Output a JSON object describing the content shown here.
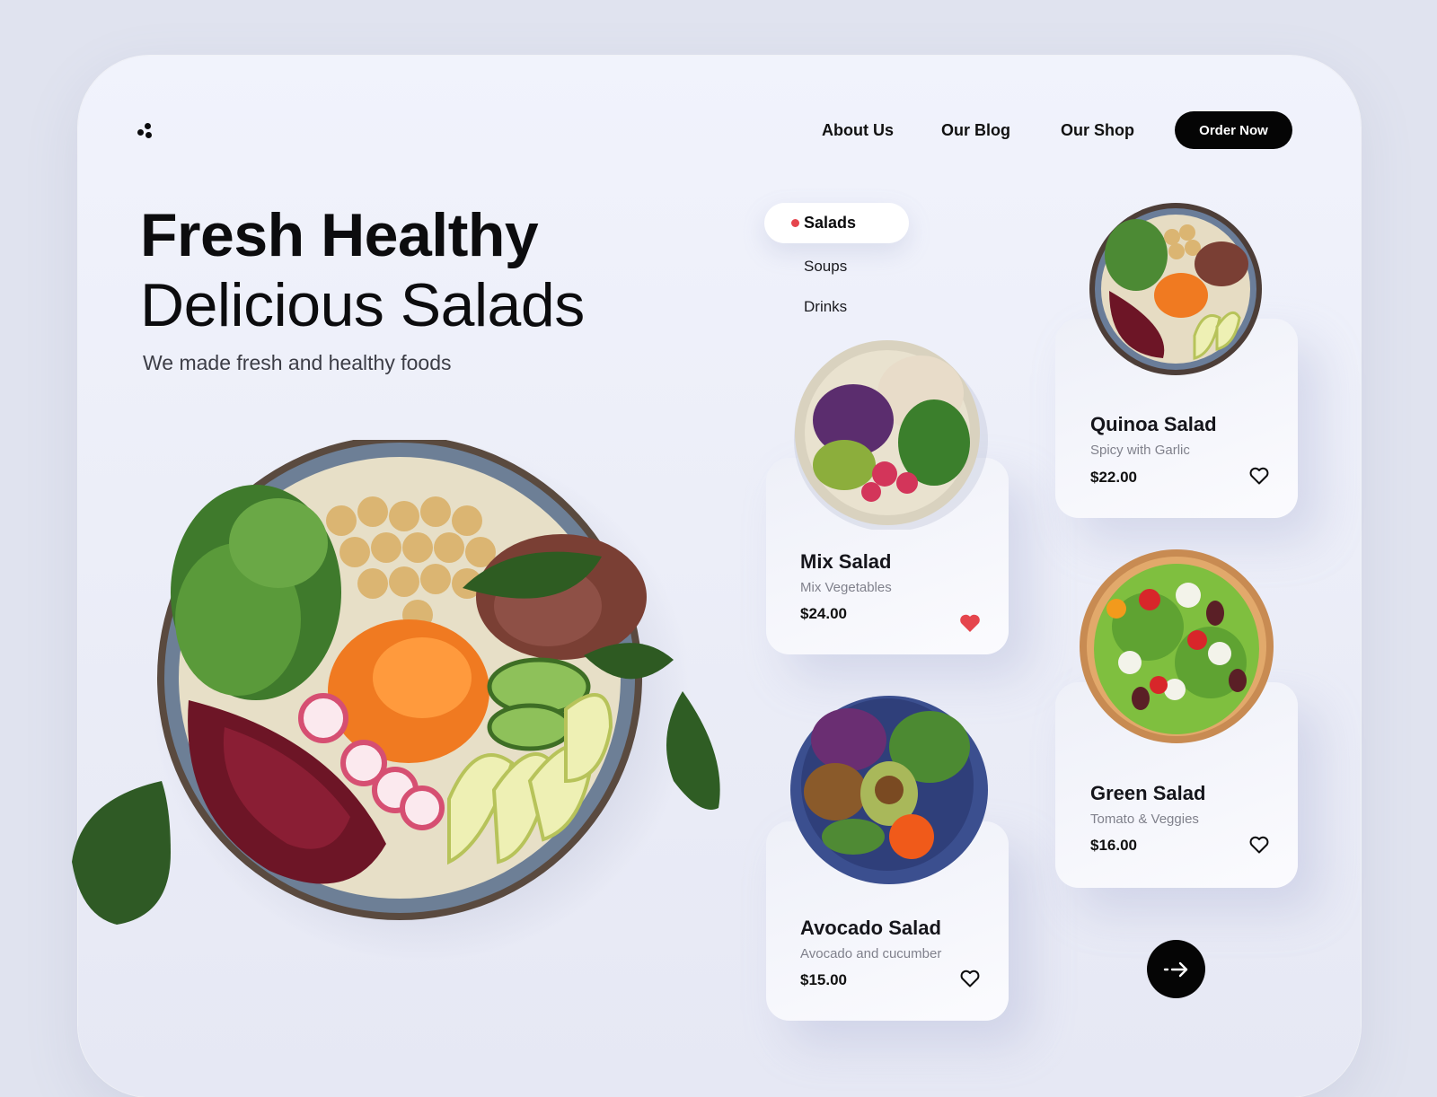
{
  "nav": {
    "links": [
      "About Us",
      "Our Blog",
      "Our Shop"
    ],
    "cta": "Order Now"
  },
  "hero": {
    "title_bold": "Fresh Healthy",
    "title_light": "Delicious Salads",
    "subtitle": "We made fresh and healthy foods"
  },
  "categories": {
    "active": "Salads",
    "others": [
      "Soups",
      "Drinks"
    ]
  },
  "products": [
    {
      "name": "Mix Salad",
      "desc": "Mix Vegetables",
      "price": "$24.00",
      "favorited": true
    },
    {
      "name": "Avocado Salad",
      "desc": "Avocado and  cucumber",
      "price": "$15.00",
      "favorited": false
    },
    {
      "name": "Quinoa Salad",
      "desc": "Spicy with Garlic",
      "price": "$22.00",
      "favorited": false
    },
    {
      "name": "Green Salad",
      "desc": "Tomato & Veggies",
      "price": "$16.00",
      "favorited": false
    }
  ],
  "colors": {
    "accent": "#e5454d",
    "dark": "#050505",
    "background": "#e0e3ef"
  },
  "icons": {
    "logo": "three-dots-logo-icon",
    "favorite": "heart-icon",
    "next": "arrow-right-icon"
  }
}
